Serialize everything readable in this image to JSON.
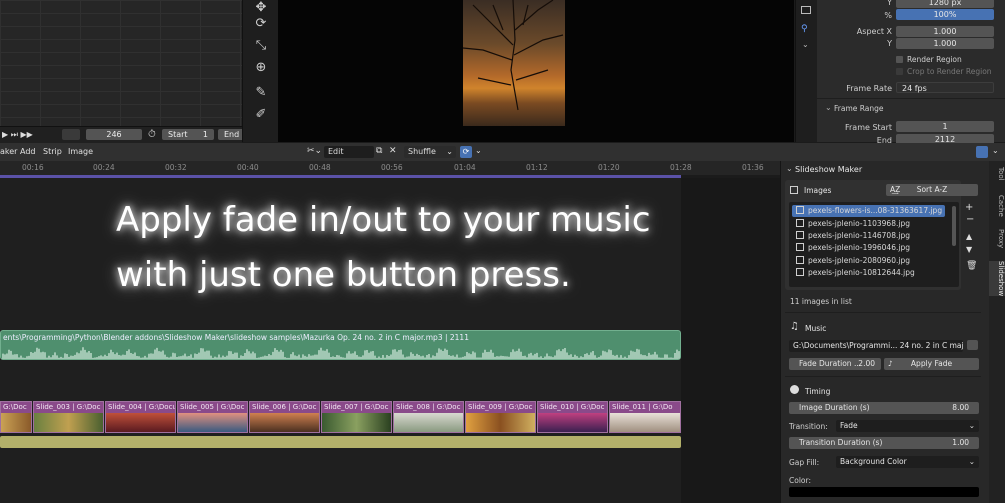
{
  "graph_bar": {
    "frame_value": "246",
    "start_label": "Start",
    "start_value": "1",
    "end_label": "End"
  },
  "preview_tools": [
    "move-icon",
    "rotate-icon",
    "scale-icon",
    "transform-icon",
    "eyedropper-icon",
    "annotate-icon"
  ],
  "properties": {
    "res_y_label": "Y",
    "res_y_value": "1280 px",
    "pct_label": "%",
    "pct_value": "100%",
    "aspect_x_label": "Aspect X",
    "aspect_x_value": "1.000",
    "aspect_y_label": "Y",
    "aspect_y_value": "1.000",
    "render_region_label": "Render Region",
    "crop_label": "Crop to Render Region",
    "frame_rate_label": "Frame Rate",
    "frame_rate_value": "24 fps",
    "frame_range_title": "Frame Range",
    "frame_start_label": "Frame Start",
    "frame_start_value": "1",
    "frame_end_label": "End",
    "frame_end_value": "2112"
  },
  "header": {
    "menus": [
      "aker",
      "Add",
      "Strip",
      "Image"
    ],
    "edit_value": "Edit",
    "shuffle_value": "Shuffle"
  },
  "ruler_ticks": [
    "00:16",
    "00:24",
    "00:32",
    "00:40",
    "00:48",
    "00:56",
    "01:04",
    "01:12",
    "01:20",
    "01:28",
    "01:36"
  ],
  "caption": {
    "line1": "Apply fade in/out to your music",
    "line2": "with just one button press."
  },
  "audio_strip": {
    "label": "ents\\Programming\\Python\\Blender addons\\Slideshow Maker\\slideshow samples\\Mazurka Op. 24 no. 2 in C major.mp3 | 2111"
  },
  "clips": [
    {
      "label": "G:\\Doc"
    },
    {
      "label": "Slide_003 | G:\\Doc"
    },
    {
      "label": "Slide_004 | G:\\Docu"
    },
    {
      "label": "Slide_005 | G:\\Doc"
    },
    {
      "label": "Slide_006 | G:\\Doc"
    },
    {
      "label": "Slide_007 | G:\\Doc"
    },
    {
      "label": "Slide_008 | G:\\Doc"
    },
    {
      "label": "Slide_009 | G:\\Doc"
    },
    {
      "label": "Slide_010 | G:\\Doc"
    },
    {
      "label": "Slide_011 | G:\\Do"
    }
  ],
  "side_tabs": [
    "Tool",
    "Cache",
    "Proxy",
    "Slideshow"
  ],
  "panel": {
    "title": "Slideshow Maker",
    "images_label": "Images",
    "sort_label": "Sort A-Z",
    "images": [
      "pexels-flowers-is...08-31363617.jpg",
      "pexels-jplenio-1103968.jpg",
      "pexels-jplenio-1146708.jpg",
      "pexels-jplenio-1996046.jpg",
      "pexels-jplenio-2080960.jpg",
      "pexels-jplenio-10812644.jpg"
    ],
    "images_count": "11 images in list",
    "music_label": "Music",
    "music_path": "G:\\Documents\\Programmi... 24 no. 2 in C major.mp3",
    "fade_label": "Fade Duration ...",
    "fade_value": "2.00",
    "apply_fade_label": "Apply Fade",
    "timing_label": "Timing",
    "image_duration_label": "Image Duration (s)",
    "image_duration_value": "8.00",
    "transition_label": "Transition:",
    "transition_value": "Fade",
    "transition_duration_label": "Transition Duration (s)",
    "transition_duration_value": "1.00",
    "gap_fill_label": "Gap Fill:",
    "gap_fill_value": "Background Color",
    "color_label": "Color:",
    "colors": {
      "accent": "#4772b3",
      "audio": "#4f8f6e",
      "clip": "#8a4a8a"
    }
  }
}
